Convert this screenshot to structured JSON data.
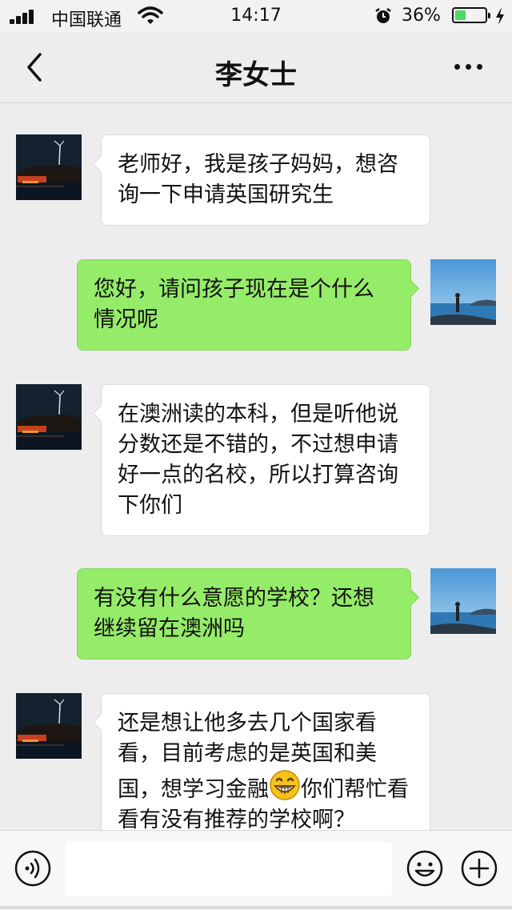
{
  "status_bar": {
    "carrier": "中国联通",
    "time": "14:17",
    "battery_percent": "36%",
    "battery_level": 0.36,
    "icons": [
      "signal-icon",
      "wifi-icon",
      "alarm-icon",
      "battery-icon",
      "charging-icon"
    ]
  },
  "nav": {
    "title": "李女士",
    "back_icon": "chevron-left-icon",
    "more_icon": "more-dots-icon"
  },
  "messages": [
    {
      "side": "left",
      "avatar": "contact-avatar",
      "text": "老师好，我是孩子妈妈，想咨询一下申请英国研究生"
    },
    {
      "side": "right",
      "avatar": "own-avatar",
      "text": "您好，请问孩子现在是个什么情况呢"
    },
    {
      "side": "left",
      "avatar": "contact-avatar",
      "text": "在澳洲读的本科，但是听他说分数还是不错的，不过想申请好一点的名校，所以打算咨询下你们"
    },
    {
      "side": "right",
      "avatar": "own-avatar",
      "text": "有没有什么意愿的学校？还想继续留在澳洲吗"
    },
    {
      "side": "left",
      "avatar": "contact-avatar",
      "text_before_emoji": "还是想让他多去几个国家看看，目前考虑的是英国和美国，想学习金融",
      "emoji": "grinning-face-emoji",
      "text_after_emoji": "你们帮忙看看有没有推荐的学校啊？"
    }
  ],
  "input_bar": {
    "value": "",
    "placeholder": "",
    "voice_icon": "voice-icon",
    "emoji_icon": "emoji-icon",
    "plus_icon": "plus-icon"
  },
  "colors": {
    "background": "#ededed",
    "outgoing_bubble": "#95ec69",
    "incoming_bubble": "#ffffff",
    "battery_fill": "#4cd964"
  }
}
